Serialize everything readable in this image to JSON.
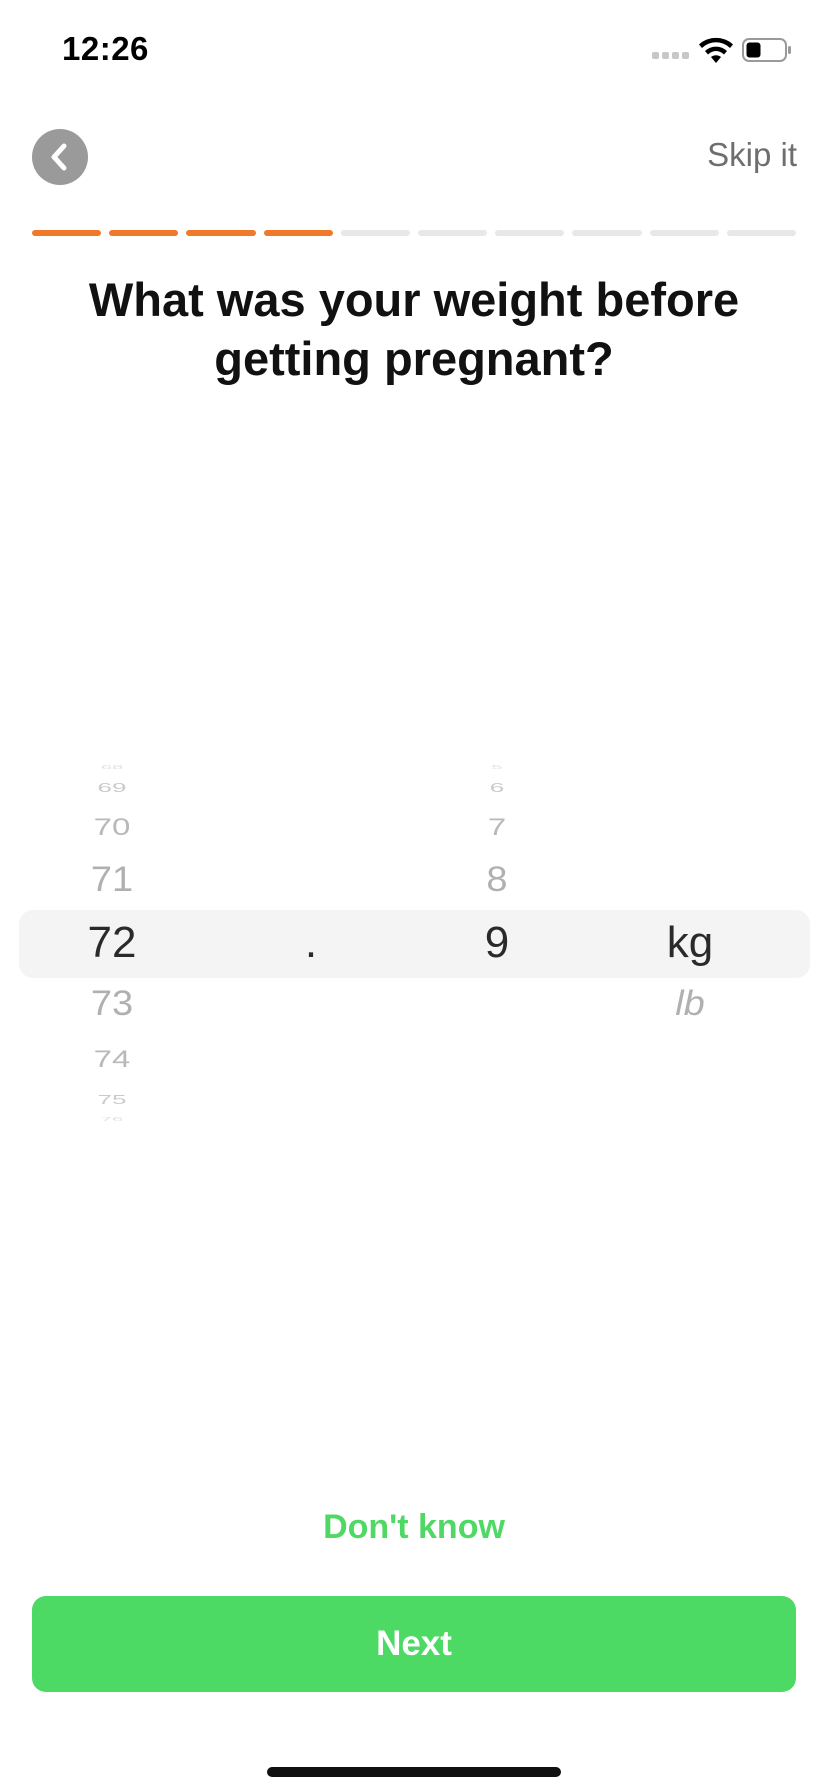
{
  "status_bar": {
    "time": "12:26"
  },
  "header": {
    "back_icon": "chevron-left-icon",
    "skip_label": "Skip it"
  },
  "progress": {
    "total_steps": 10,
    "completed_steps": 4,
    "color_done": "#f07a2a",
    "color_todo": "#e8e8e8"
  },
  "question": {
    "text": "What was your weight before getting pregnant?"
  },
  "picker": {
    "integer_column": {
      "values": [
        "68",
        "69",
        "70",
        "71",
        "72",
        "73",
        "74",
        "75",
        "76"
      ],
      "selected": "72"
    },
    "separator": ".",
    "decimal_column": {
      "values": [
        "5",
        "6",
        "7",
        "8",
        "9"
      ],
      "selected": "9"
    },
    "unit_column": {
      "values": [
        "kg",
        "lb"
      ],
      "selected": "kg"
    }
  },
  "actions": {
    "dont_know_label": "Don't know",
    "next_label": "Next"
  },
  "colors": {
    "accent_green": "#4cd964",
    "accent_orange": "#f07a2a"
  }
}
